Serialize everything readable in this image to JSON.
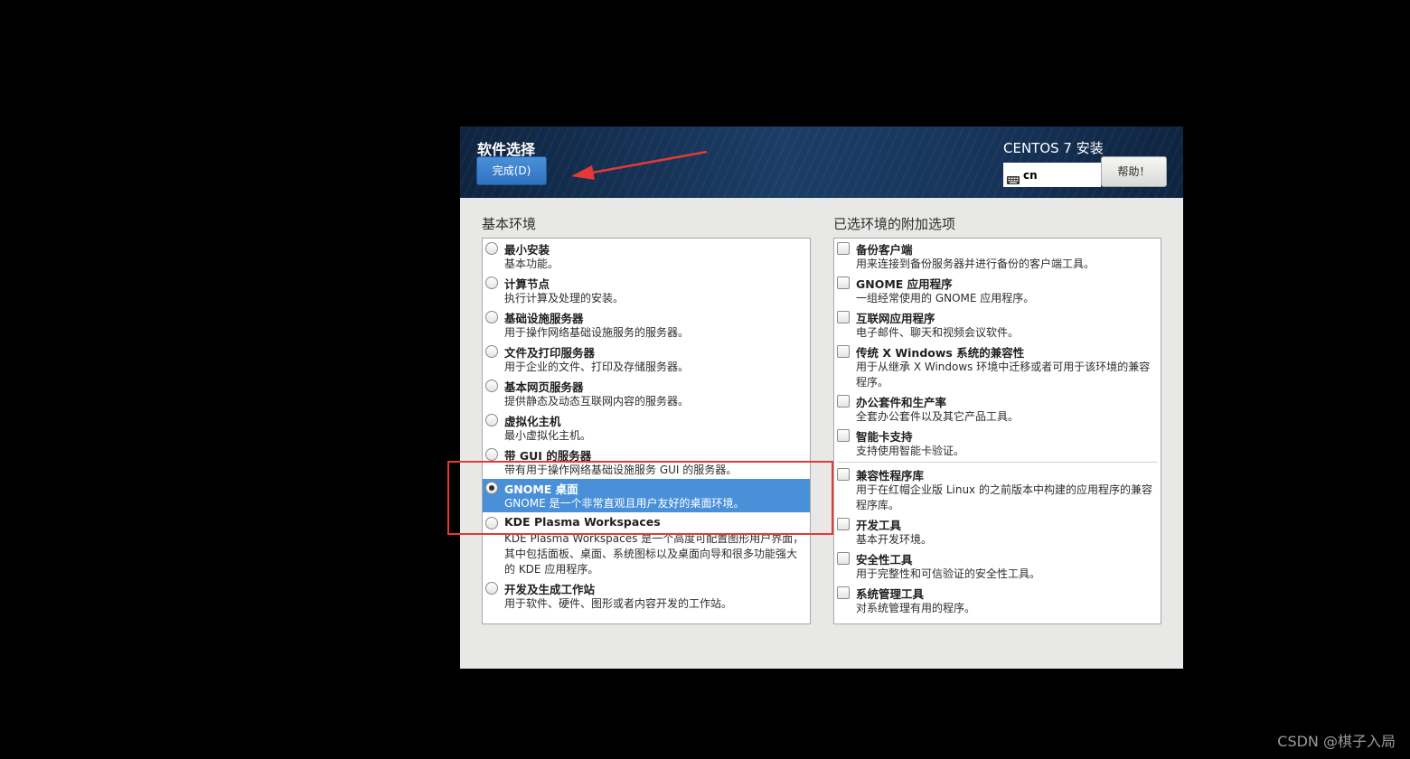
{
  "header": {
    "title": "软件选择",
    "done_button": "完成(D)",
    "product": "CENTOS 7 安装",
    "keyboard_layout": "cn",
    "help_button": "帮助！",
    "keyboard_icon": "keyboard-icon"
  },
  "base_environment": {
    "title": "基本环境",
    "selected_index": 7,
    "items": [
      {
        "name": "最小安装",
        "desc": "基本功能。"
      },
      {
        "name": "计算节点",
        "desc": "执行计算及处理的安装。"
      },
      {
        "name": "基础设施服务器",
        "desc": "用于操作网络基础设施服务的服务器。"
      },
      {
        "name": "文件及打印服务器",
        "desc": "用于企业的文件、打印及存储服务器。"
      },
      {
        "name": "基本网页服务器",
        "desc": "提供静态及动态互联网内容的服务器。"
      },
      {
        "name": "虚拟化主机",
        "desc": "最小虚拟化主机。"
      },
      {
        "name": "带 GUI 的服务器",
        "desc": "带有用于操作网络基础设施服务 GUI 的服务器。"
      },
      {
        "name": "GNOME 桌面",
        "desc": "GNOME 是一个非常直观且用户友好的桌面环境。"
      },
      {
        "name": "KDE Plasma Workspaces",
        "desc": "KDE Plasma Workspaces 是一个高度可配置图形用户界面，其中包括面板、桌面、系统图标以及桌面向导和很多功能强大的 KDE 应用程序。"
      },
      {
        "name": "开发及生成工作站",
        "desc": "用于软件、硬件、图形或者内容开发的工作站。"
      }
    ]
  },
  "addons": {
    "title": "已选环境的附加选项",
    "items": [
      {
        "name": "备份客户端",
        "desc": "用来连接到备份服务器并进行备份的客户端工具。",
        "checked": false
      },
      {
        "name": "GNOME 应用程序",
        "desc": "一组经常使用的 GNOME 应用程序。",
        "checked": false
      },
      {
        "name": "互联网应用程序",
        "desc": "电子邮件、聊天和视频会议软件。",
        "checked": false
      },
      {
        "name": "传统 X Windows 系统的兼容性",
        "desc": "用于从继承 X Windows 环境中迁移或者可用于该环境的兼容程序。",
        "checked": false
      },
      {
        "name": "办公套件和生产率",
        "desc": "全套办公套件以及其它产品工具。",
        "checked": false
      },
      {
        "name": "智能卡支持",
        "desc": "支持使用智能卡验证。",
        "checked": false
      },
      {
        "name": "兼容性程序库",
        "desc": "用于在红帽企业版 Linux 的之前版本中构建的应用程序的兼容程序库。",
        "checked": false
      },
      {
        "name": "开发工具",
        "desc": "基本开发环境。",
        "checked": false
      },
      {
        "name": "安全性工具",
        "desc": "用于完整性和可信验证的安全性工具。",
        "checked": false
      },
      {
        "name": "系统管理工具",
        "desc": "对系统管理有用的程序。",
        "checked": false
      }
    ]
  },
  "annotation": {
    "color": "#e53935"
  },
  "watermark": "CSDN @棋子入局"
}
